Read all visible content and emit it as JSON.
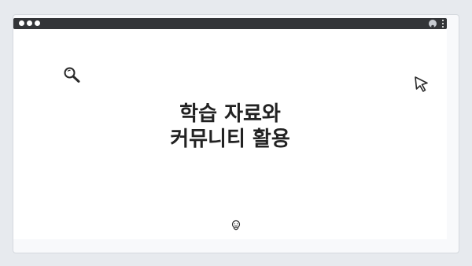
{
  "headline": {
    "line1": "학습 자료와",
    "line2": "커뮤니티 활용"
  },
  "icons": {
    "search": "search-icon",
    "cursor": "cursor-icon",
    "face": "face-icon",
    "user": "user-icon",
    "menu": "more-vertical-icon"
  },
  "colors": {
    "titlebar": "#333538",
    "background": "#e7eaee",
    "text": "#222222"
  }
}
